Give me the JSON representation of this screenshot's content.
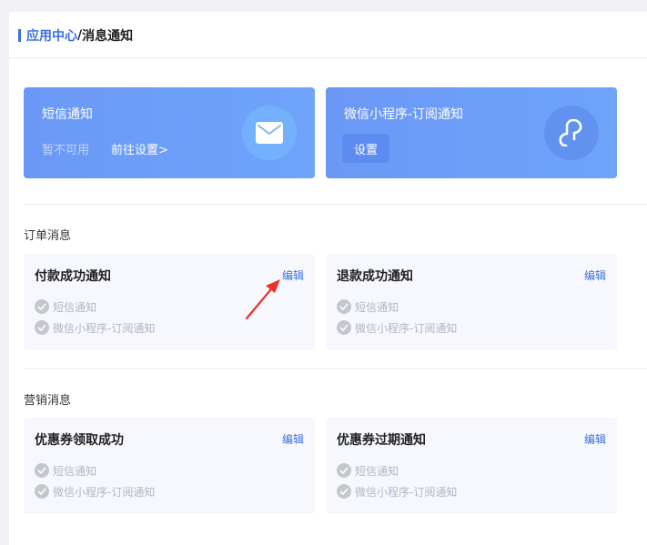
{
  "breadcrumb": {
    "parent": "应用中心",
    "separator": "/",
    "current": "消息通知"
  },
  "channels": {
    "sms": {
      "title": "短信通知",
      "status": "暂不可用",
      "link": "前往设置>",
      "icon": "mail-icon"
    },
    "wechat": {
      "title": "微信小程序-订阅通知",
      "button": "设置",
      "icon": "mini-program-icon"
    }
  },
  "sections": {
    "order": {
      "title": "订单消息",
      "cards": [
        {
          "title": "付款成功通知",
          "edit": "编辑",
          "channels": [
            "短信通知",
            "微信小程序-订阅通知"
          ]
        },
        {
          "title": "退款成功通知",
          "edit": "编辑",
          "channels": [
            "短信通知",
            "微信小程序-订阅通知"
          ]
        }
      ]
    },
    "marketing": {
      "title": "营销消息",
      "cards": [
        {
          "title": "优惠券领取成功",
          "edit": "编辑",
          "channels": [
            "短信通知",
            "微信小程序-订阅通知"
          ]
        },
        {
          "title": "优惠券过期通知",
          "edit": "编辑",
          "channels": [
            "短信通知",
            "微信小程序-订阅通知"
          ]
        }
      ]
    }
  },
  "colors": {
    "accent": "#3a6fe0",
    "card_bg": "#f6f8fd",
    "annotation_arrow": "#e8332a"
  }
}
